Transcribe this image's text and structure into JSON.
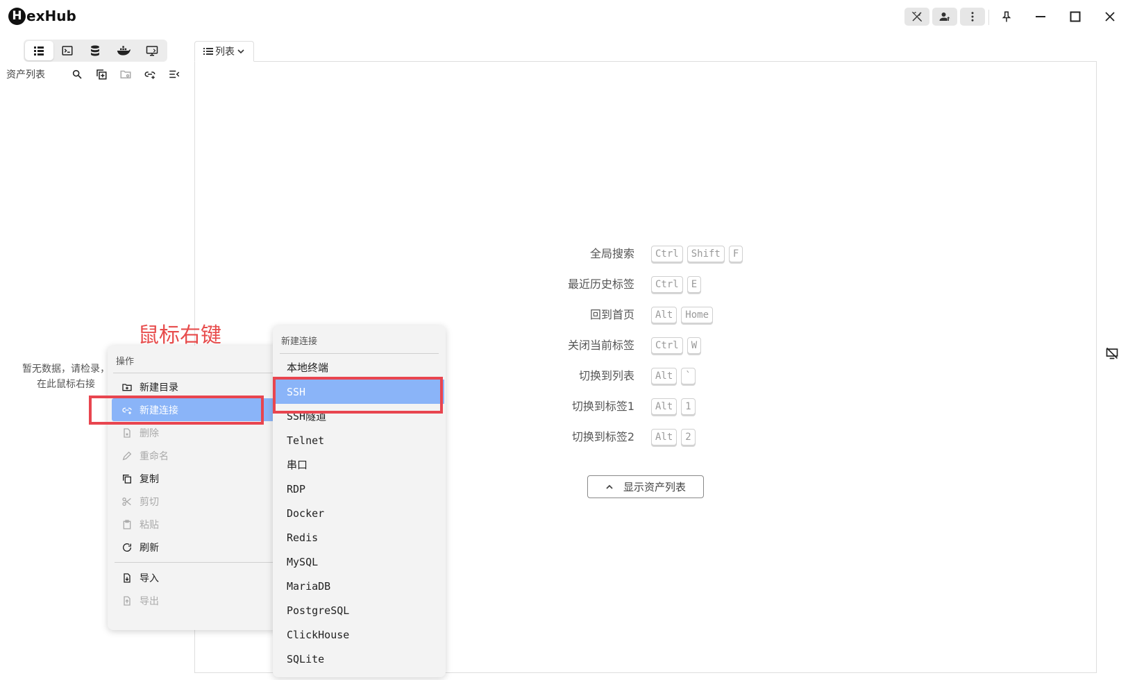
{
  "app": {
    "name_initial": "H",
    "name_rest": "exHub"
  },
  "titlebar_icons": [
    "magic-off-icon",
    "user-upload-icon",
    "more-vertical-icon",
    "pin-icon",
    "minimize-icon",
    "maximize-icon",
    "close-icon"
  ],
  "sidebar": {
    "tabs": [
      "list-icon",
      "terminal-icon",
      "database-icon",
      "docker-icon",
      "monitor-icon"
    ],
    "title": "资产列表",
    "empty_text": "暂无数据，请检录，在此鼠标右接"
  },
  "main": {
    "tab_label": "列表",
    "shortcuts": [
      {
        "label": "全局搜索",
        "keys": [
          "Ctrl",
          "Shift",
          "F"
        ]
      },
      {
        "label": "最近历史标签",
        "keys": [
          "Ctrl",
          "E"
        ]
      },
      {
        "label": "回到首页",
        "keys": [
          "Alt",
          "Home"
        ]
      },
      {
        "label": "关闭当前标签",
        "keys": [
          "Ctrl",
          "W"
        ]
      },
      {
        "label": "切换到列表",
        "keys": [
          "Alt",
          "`"
        ]
      },
      {
        "label": "切换到标签1",
        "keys": [
          "Alt",
          "1"
        ]
      },
      {
        "label": "切换到标签2",
        "keys": [
          "Alt",
          "2"
        ]
      }
    ],
    "show_assets_button": "显示资产列表"
  },
  "context_menu": {
    "title": "操作",
    "items": [
      {
        "label": "新建目录",
        "icon": "folder-plus-icon",
        "disabled": false
      },
      {
        "label": "新建连接",
        "icon": "link-plus-icon",
        "disabled": false,
        "highlighted": true
      },
      {
        "label": "删除",
        "icon": "file-delete-icon",
        "disabled": true
      },
      {
        "label": "重命名",
        "icon": "pencil-icon",
        "disabled": true
      },
      {
        "label": "复制",
        "icon": "copy-icon",
        "disabled": false
      },
      {
        "label": "剪切",
        "icon": "scissors-icon",
        "disabled": true
      },
      {
        "label": "粘贴",
        "icon": "clipboard-icon",
        "disabled": true
      },
      {
        "label": "刷新",
        "icon": "refresh-icon",
        "disabled": false
      },
      {
        "label": "导入",
        "icon": "file-import-icon",
        "disabled": false
      },
      {
        "label": "导出",
        "icon": "file-export-icon",
        "disabled": true
      }
    ]
  },
  "submenu": {
    "title": "新建连接",
    "items": [
      "本地终端",
      "SSH",
      "SSH隧道",
      "Telnet",
      "串口",
      "RDP",
      "Docker",
      "Redis",
      "MySQL",
      "MariaDB",
      "PostgreSQL",
      "ClickHouse",
      "SQLite"
    ],
    "highlighted": "SSH"
  },
  "annotation": {
    "text": "鼠标右键",
    "color": "#e74c4c"
  },
  "colors": {
    "highlight": "#8ab4f8",
    "annotation_box": "#e8454f"
  }
}
